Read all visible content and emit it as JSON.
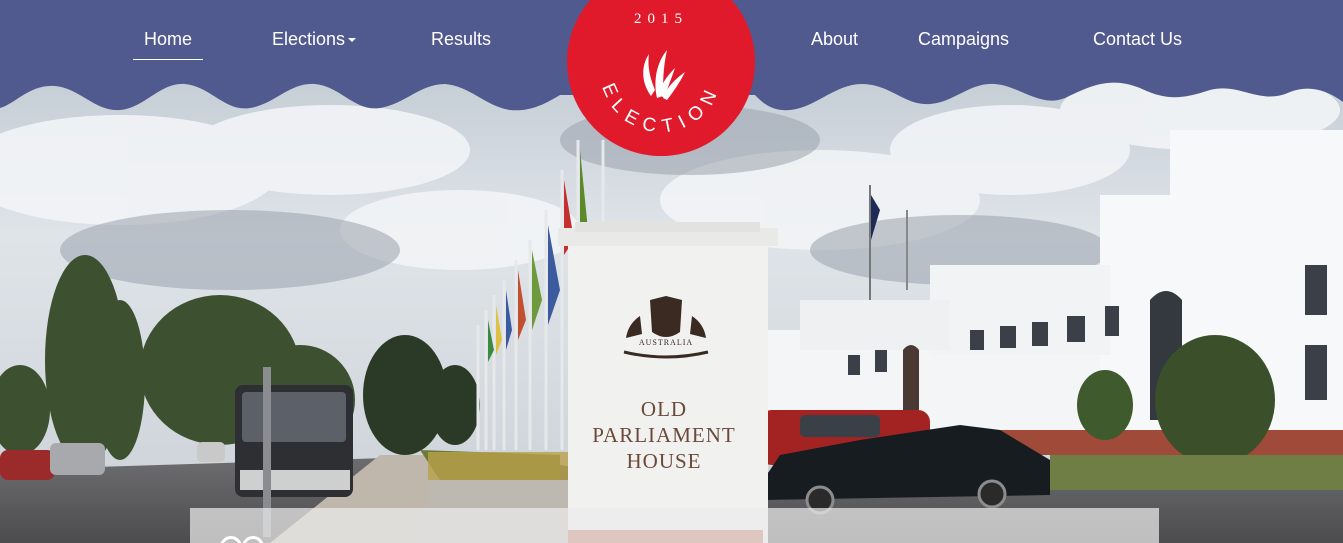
{
  "nav": {
    "items": [
      {
        "label": "Home",
        "active": true
      },
      {
        "label": "Elections",
        "has_dropdown": true
      },
      {
        "label": "Results"
      },
      {
        "label": "About"
      },
      {
        "label": "Campaigns"
      },
      {
        "label": "Contact Us"
      }
    ]
  },
  "logo": {
    "year": "2015",
    "word": "ELECTION",
    "icon": "flame-leaves-icon"
  },
  "hero": {
    "sign_lines": [
      "OLD",
      "PARLIAMENT",
      "HOUSE"
    ],
    "crest_text": "AUSTRALIA"
  },
  "colors": {
    "nav_bg": "#505a8f",
    "logo_red": "#e11a2b",
    "text": "#ffffff"
  }
}
